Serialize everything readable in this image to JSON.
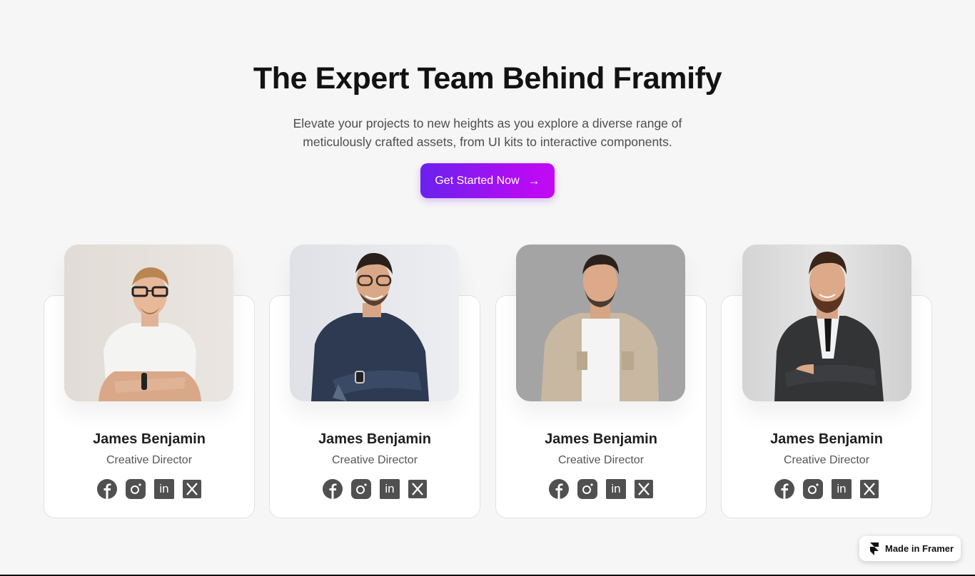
{
  "hero": {
    "title": "The Expert Team Behind Framify",
    "subtitle": "Elevate your projects to new heights as you explore a diverse range of meticulously crafted assets, from UI kits to interactive components.",
    "cta_label": "Get Started Now",
    "cta_icon": "arrow-right-icon",
    "cta_gradient": [
      "#6a22ee",
      "#c409f5"
    ]
  },
  "team": {
    "members": [
      {
        "name": "James Benjamin",
        "role": "Creative Director",
        "photo": "man-glasses-white-tshirt",
        "photo_bg": "#e6e1dc"
      },
      {
        "name": "James Benjamin",
        "role": "Creative Director",
        "photo": "man-glasses-denim-shirt",
        "photo_bg": "#e4e6ea"
      },
      {
        "name": "James Benjamin",
        "role": "Creative Director",
        "photo": "man-beige-jacket",
        "photo_bg": "#a3a3a3"
      },
      {
        "name": "James Benjamin",
        "role": "Creative Director",
        "photo": "man-dark-suit",
        "photo_bg": "#dcdcdc"
      }
    ],
    "socials": [
      {
        "icon": "facebook-icon",
        "glyph": "f"
      },
      {
        "icon": "instagram-icon",
        "glyph": ""
      },
      {
        "icon": "linkedin-icon",
        "glyph": "in"
      },
      {
        "icon": "x-icon",
        "glyph": ""
      }
    ]
  },
  "badge": {
    "label": "Made in Framer",
    "icon": "framer-logo-icon"
  }
}
